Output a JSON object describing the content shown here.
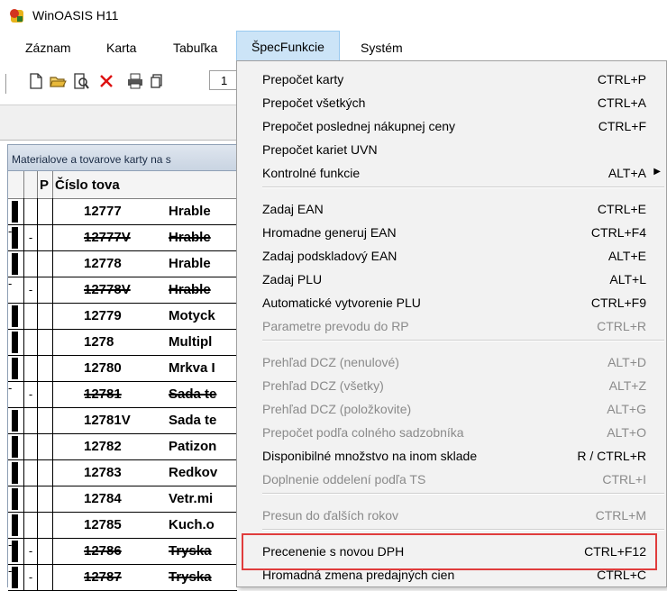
{
  "window": {
    "title": "WinOASIS H11"
  },
  "menubar": [
    "Záznam",
    "Karta",
    "Tabuľka",
    "ŠpecFunkcie",
    "Systém"
  ],
  "toolbar": {
    "icons": [
      "new-document-icon",
      "open-folder-icon",
      "print-preview-icon",
      "delete-icon",
      "print-icon",
      "copy-icon"
    ],
    "field_value": "1"
  },
  "inner_window": {
    "title": "Materialove a tovarove karty na s"
  },
  "grid": {
    "headers": {
      "flag": "P",
      "code": "Číslo tova"
    },
    "rows": [
      {
        "a": "",
        "b": "",
        "c": "",
        "code": "12777",
        "name": "Hrable",
        "black": true,
        "strike": false
      },
      {
        "a": "-",
        "b": "-",
        "c": "",
        "code": "12777V",
        "name": "Hrable",
        "black": true,
        "strike": true
      },
      {
        "a": "",
        "b": "",
        "c": "",
        "code": "12778",
        "name": "Hrable",
        "black": true,
        "strike": false
      },
      {
        "a": "-",
        "b": "-",
        "c": "",
        "code": "12778V",
        "name": "Hrable",
        "black": false,
        "strike": true
      },
      {
        "a": "",
        "b": "",
        "c": "",
        "code": "12779",
        "name": "Motyck",
        "black": true,
        "strike": false
      },
      {
        "a": "",
        "b": "",
        "c": "",
        "code": "1278",
        "name": "Multipl",
        "black": true,
        "strike": false
      },
      {
        "a": "",
        "b": "",
        "c": "",
        "code": "12780",
        "name": "Mrkva I",
        "black": true,
        "strike": false
      },
      {
        "a": "-",
        "b": "-",
        "c": "",
        "code": "12781",
        "name": "Sada te",
        "black": false,
        "strike": true
      },
      {
        "a": "",
        "b": "",
        "c": "",
        "code": "12781V",
        "name": "Sada te",
        "black": true,
        "strike": false
      },
      {
        "a": "",
        "b": "",
        "c": "",
        "code": "12782",
        "name": "Patizon",
        "black": true,
        "strike": false
      },
      {
        "a": "",
        "b": "",
        "c": "",
        "code": "12783",
        "name": "Redkov",
        "black": true,
        "strike": false
      },
      {
        "a": "",
        "b": "",
        "c": "",
        "code": "12784",
        "name": "Vetr.mi",
        "black": true,
        "strike": false
      },
      {
        "a": "",
        "b": "",
        "c": "",
        "code": "12785",
        "name": "Kuch.o",
        "black": true,
        "strike": false
      },
      {
        "a": "-",
        "b": "-",
        "c": "",
        "code": "12786",
        "name": "Tryska",
        "black": true,
        "strike": true
      },
      {
        "a": "-",
        "b": "-",
        "c": "",
        "code": "12787",
        "name": "Tryska",
        "black": true,
        "strike": true
      }
    ]
  },
  "dropdown": {
    "items": [
      {
        "label": "Prepočet karty",
        "shortcut": "CTRL+P",
        "disabled": false
      },
      {
        "label": "Prepočet všetkých",
        "shortcut": "CTRL+A",
        "disabled": false
      },
      {
        "label": "Prepočet poslednej nákupnej ceny",
        "shortcut": "CTRL+F",
        "disabled": false
      },
      {
        "label": "Prepočet kariet UVN",
        "shortcut": "",
        "disabled": false
      },
      {
        "label": "Kontrolné funkcie",
        "shortcut": "ALT+A",
        "disabled": false,
        "submenu": true
      },
      {
        "label": "Zadaj EAN",
        "shortcut": "CTRL+E",
        "disabled": false
      },
      {
        "label": "Hromadne generuj  EAN",
        "shortcut": "CTRL+F4",
        "disabled": false
      },
      {
        "label": "Zadaj podskladový EAN",
        "shortcut": "ALT+E",
        "disabled": false
      },
      {
        "label": "Zadaj PLU",
        "shortcut": "ALT+L",
        "disabled": false
      },
      {
        "label": "Automatické vytvorenie PLU",
        "shortcut": "CTRL+F9",
        "disabled": false
      },
      {
        "label": "Parametre prevodu do RP",
        "shortcut": "CTRL+R",
        "disabled": true
      },
      {
        "label": "Prehľad DCZ (nenulové)",
        "shortcut": "ALT+D",
        "disabled": true
      },
      {
        "label": "Prehľad DCZ (všetky)",
        "shortcut": "ALT+Z",
        "disabled": true
      },
      {
        "label": "Prehľad DCZ (položkovite)",
        "shortcut": "ALT+G",
        "disabled": true
      },
      {
        "label": "Prepočet podľa colného sadzobníka",
        "shortcut": "ALT+O",
        "disabled": true
      },
      {
        "label": "Disponibilné množstvo na inom sklade",
        "shortcut": "R / CTRL+R",
        "disabled": false
      },
      {
        "label": "Doplnenie oddelení podľa TS",
        "shortcut": "CTRL+I",
        "disabled": true
      },
      {
        "label": "Presun do ďalších rokov",
        "shortcut": "CTRL+M",
        "disabled": true
      },
      {
        "label": "Precenenie s novou DPH",
        "shortcut": "CTRL+F12",
        "disabled": false
      },
      {
        "label": "Hromadná zmena predajných cien",
        "shortcut": "CTRL+C",
        "disabled": false
      }
    ]
  },
  "colors": {
    "highlight_border": "#e03c3c",
    "menu_active": "#cce4f7"
  }
}
